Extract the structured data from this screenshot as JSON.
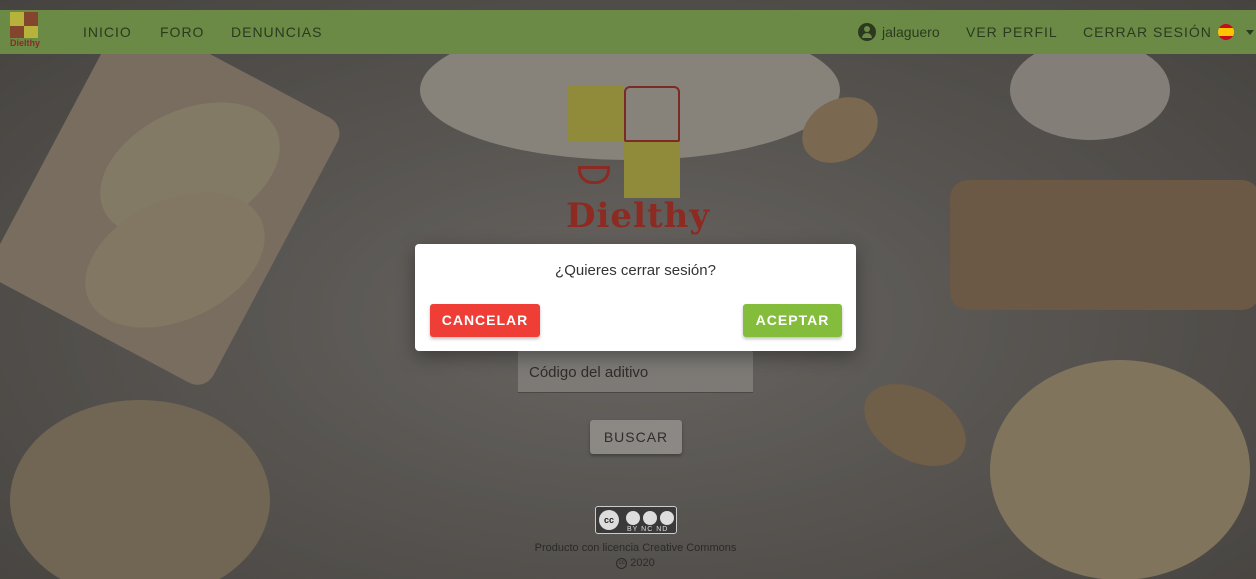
{
  "navbar": {
    "logo_text": "Dielthy",
    "links": [
      "INICIO",
      "FORO",
      "DENUNCIAS"
    ],
    "username": "jalaguero",
    "view_profile": "VER PERFIL",
    "logout": "CERRAR SESIÓN"
  },
  "brand": {
    "name": "Dielthy"
  },
  "form": {
    "input_placeholder": "Código del aditivo",
    "search_button": "BUSCAR"
  },
  "footer": {
    "license_badge": "BY NC ND",
    "license_text": "Producto con licencia Creative Commons",
    "year": "2020"
  },
  "dialog": {
    "question": "¿Quieres cerrar sesión?",
    "cancel": "CANCELAR",
    "accept": "ACEPTAR"
  },
  "colors": {
    "navbar": "#6b8a45",
    "cancel": "#ef3e36",
    "accept": "#84bd3b"
  }
}
